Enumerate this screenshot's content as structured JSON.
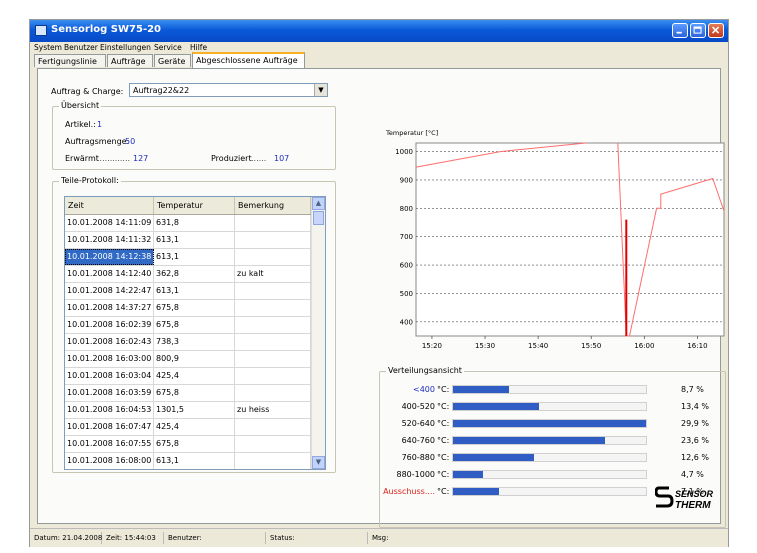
{
  "window": {
    "title": "Sensorlog SW75-20"
  },
  "menu": [
    "System",
    "Benutzer",
    "Einstellungen",
    "Service",
    "Hilfe"
  ],
  "tabs": [
    "Fertigungslinie",
    "Aufträge",
    "Geräte",
    "Abgeschlossene Aufträge"
  ],
  "order": {
    "label": "Auftrag & Charge:",
    "value": "Auftrag22&22"
  },
  "overview": {
    "title": "Übersicht",
    "artikel_label": "Artikel.:",
    "artikel_value": "1",
    "menge_label": "Auftragsmenge:",
    "menge_value": "50",
    "erwaermt_label": "Erwärmt",
    "erwaermt_value": "127",
    "produziert_label": "Produziert",
    "produziert_value": "107"
  },
  "protocol": {
    "title": "Teile-Protokoll:",
    "columns": [
      "Zeit",
      "Temperatur",
      "Bemerkung"
    ],
    "rows": [
      [
        "10.01.2008 14:11:09",
        "631,8",
        ""
      ],
      [
        "10.01.2008 14:11:32",
        "613,1",
        ""
      ],
      [
        "10.01.2008 14:12:38",
        "613,1",
        ""
      ],
      [
        "10.01.2008 14:12:40",
        "362,8",
        "zu kalt"
      ],
      [
        "10.01.2008 14:22:47",
        "613,1",
        ""
      ],
      [
        "10.01.2008 14:37:27",
        "675,8",
        ""
      ],
      [
        "10.01.2008 16:02:39",
        "675,8",
        ""
      ],
      [
        "10.01.2008 16:02:43",
        "738,3",
        ""
      ],
      [
        "10.01.2008 16:03:00",
        "800,9",
        ""
      ],
      [
        "10.01.2008 16:03:04",
        "425,4",
        ""
      ],
      [
        "10.01.2008 16:03:59",
        "675,8",
        ""
      ],
      [
        "10.01.2008 16:04:53",
        "1301,5",
        "zu heiss"
      ],
      [
        "10.01.2008 16:07:47",
        "425,4",
        ""
      ],
      [
        "10.01.2008 16:07:55",
        "675,8",
        ""
      ],
      [
        "10.01.2008 16:08:00",
        "613,1",
        ""
      ]
    ],
    "selected_row": 2
  },
  "chart_data": {
    "type": "line",
    "ylabel": "Temperatur [°C]",
    "ylim": [
      350,
      1030
    ],
    "yticks": [
      400,
      500,
      600,
      700,
      800,
      900,
      1000
    ],
    "xtick_labels": [
      "15:20",
      "15:30",
      "15:40",
      "15:50",
      "16:00",
      "16:10"
    ],
    "xtick_minutes": [
      920,
      930,
      940,
      950,
      960,
      970
    ],
    "xlim": [
      917,
      975
    ],
    "grid": true,
    "series": [
      {
        "color": "#ff6d6d",
        "points": [
          [
            917,
            945
          ],
          [
            933,
            1000
          ],
          [
            949,
            1030
          ]
        ]
      },
      {
        "color": "#ff6d6d",
        "points": [
          [
            955,
            1030
          ],
          [
            956.6,
            350
          ],
          [
            957.2,
            350
          ],
          [
            962.3,
            800
          ],
          [
            963.1,
            800
          ],
          [
            963.1,
            850
          ],
          [
            972.9,
            905
          ],
          [
            975,
            790
          ]
        ]
      },
      {
        "color": "#e00000",
        "points": [
          [
            956.6,
            760
          ],
          [
            956.6,
            350
          ]
        ]
      }
    ],
    "scale_bar": [
      {
        "color": "#ff0000",
        "share": 0.03
      },
      {
        "color": "#008000",
        "share": 0.81
      },
      {
        "color": "#0000d0",
        "share": 0.07
      },
      {
        "color": "#000000",
        "share": 0.04
      }
    ]
  },
  "distribution": {
    "title": "Verteilungsansicht",
    "unit": "°C:",
    "rows": [
      {
        "label": "<400",
        "value": 8.7,
        "pct": "8,7 %",
        "color": "#1c2dbe"
      },
      {
        "label": "400-520",
        "value": 13.4,
        "pct": "13,4 %",
        "color": "#000000"
      },
      {
        "label": "520-640",
        "value": 29.9,
        "pct": "29,9 %",
        "color": "#000000"
      },
      {
        "label": "640-760",
        "value": 23.6,
        "pct": "23,6 %",
        "color": "#000000"
      },
      {
        "label": "760-880",
        "value": 12.6,
        "pct": "12,6 %",
        "color": "#000000"
      },
      {
        "label": "880-1000",
        "value": 4.7,
        "pct": "4,7 %",
        "color": "#000000"
      },
      {
        "label": "Ausschuss....",
        "value": 7.1,
        "pct": "7,1 %",
        "color": "#e0201a"
      }
    ],
    "max_value": 29.9
  },
  "logo": {
    "line1": "SENSOR",
    "line2": "THERM"
  },
  "statusbar": {
    "datum": "Datum: 21.04.2008",
    "zeit": "Zeit: 15:44:03",
    "benutzer": "Benutzer:",
    "status": "Status:",
    "msg": "Msg:"
  }
}
